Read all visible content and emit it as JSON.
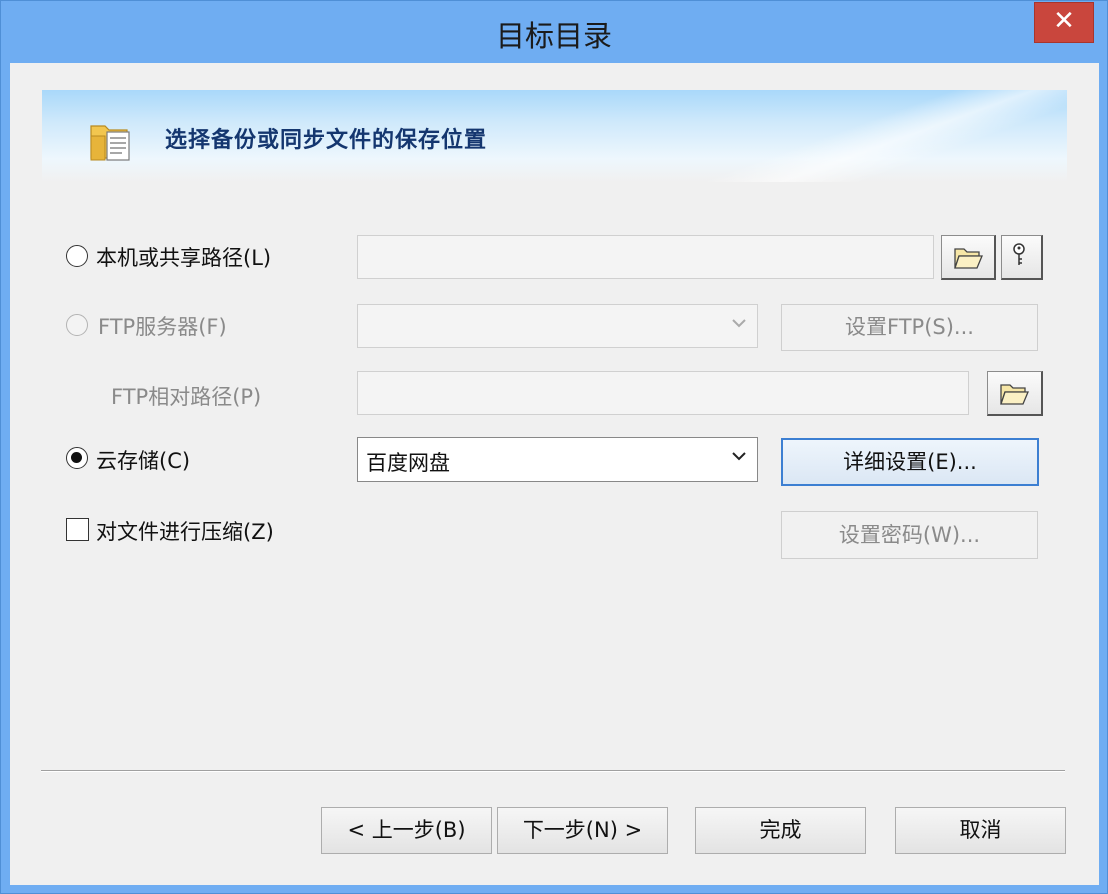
{
  "window": {
    "title": "目标目录"
  },
  "banner": {
    "title": "选择备份或同步文件的保存位置"
  },
  "local": {
    "label": "本机或共享路径(L)",
    "path_value": "",
    "browse_icon": "folder-open-icon",
    "credentials_icon": "key-icon"
  },
  "ftp": {
    "label": "FTP服务器(F)",
    "server_value": "",
    "settings_button": "设置FTP(S)...",
    "relative_path_label": "FTP相对路径(P)",
    "relative_path_value": ""
  },
  "cloud": {
    "label": "云存储(C)",
    "provider_value": "百度网盘",
    "details_button": "详细设置(E)..."
  },
  "compress": {
    "label": "对文件进行压缩(Z)",
    "checked": false,
    "password_button": "设置密码(W)..."
  },
  "footer": {
    "back_button": "< 上一步(B)",
    "next_button": "下一步(N) >",
    "finish_button": "完成",
    "cancel_button": "取消"
  },
  "colors": {
    "title_bar": "#6fadf2",
    "close_button": "#c9463d",
    "banner_title": "#14366f",
    "focus_border": "#3c7fd2"
  }
}
